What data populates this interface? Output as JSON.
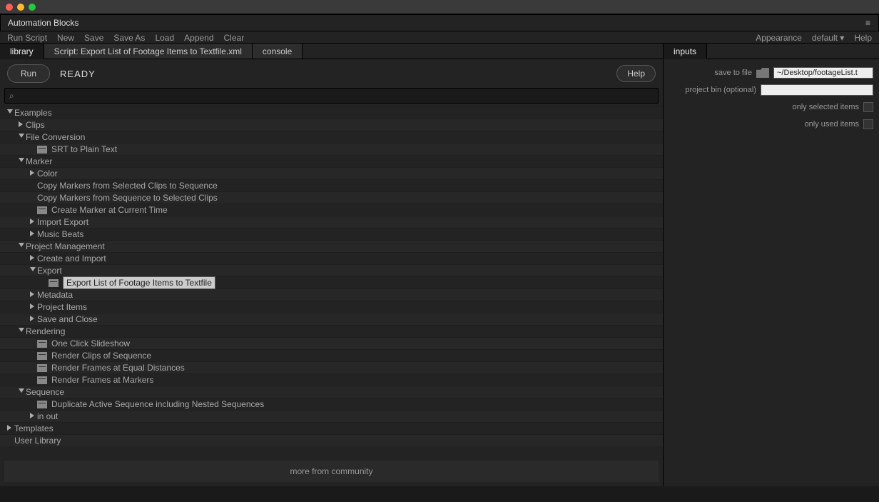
{
  "panel_title": "Automation Blocks",
  "toolbar": {
    "items": [
      "Run Script",
      "New",
      "Save",
      "Save As",
      "Load",
      "Append",
      "Clear"
    ],
    "right": {
      "appearance": "Appearance",
      "preset": "default",
      "help": "Help"
    }
  },
  "tabs": {
    "library": "library",
    "script": "Script: Export List of Footage Items to Textfile.xml",
    "console": "console"
  },
  "run_button": "Run",
  "status": "READY",
  "help_button": "Help",
  "search_placeholder": "",
  "more_row": "more from community",
  "right_panel": {
    "tab": "inputs",
    "rows": {
      "save_to_file": {
        "label": "save to file",
        "value": "~/Desktop/footageList.t"
      },
      "project_bin": {
        "label": "project bin (optional)",
        "value": ""
      },
      "only_selected": {
        "label": "only selected items",
        "checked": false
      },
      "only_used": {
        "label": "only used items",
        "checked": false
      }
    }
  },
  "tree": [
    {
      "d": 0,
      "a": "down",
      "t": "Examples"
    },
    {
      "d": 1,
      "a": "right",
      "t": "Clips"
    },
    {
      "d": 1,
      "a": "down",
      "t": "File Conversion"
    },
    {
      "d": 2,
      "a": "",
      "i": true,
      "t": "SRT to Plain Text"
    },
    {
      "d": 1,
      "a": "down",
      "t": "Marker"
    },
    {
      "d": 2,
      "a": "right",
      "t": "Color"
    },
    {
      "d": 2,
      "a": "",
      "t": "Copy Markers from Selected Clips to Sequence"
    },
    {
      "d": 2,
      "a": "",
      "t": "Copy Markers from Sequence to Selected Clips"
    },
    {
      "d": 2,
      "a": "",
      "i": true,
      "t": "Create Marker at Current Time"
    },
    {
      "d": 2,
      "a": "right",
      "t": "Import Export"
    },
    {
      "d": 2,
      "a": "right",
      "t": "Music Beats"
    },
    {
      "d": 1,
      "a": "down",
      "t": "Project Management"
    },
    {
      "d": 2,
      "a": "right",
      "t": "Create and Import"
    },
    {
      "d": 2,
      "a": "down",
      "t": "Export"
    },
    {
      "d": 3,
      "a": "",
      "i": true,
      "t": "Export List of Footage Items to Textfile",
      "sel": true
    },
    {
      "d": 2,
      "a": "right",
      "t": "Metadata"
    },
    {
      "d": 2,
      "a": "right",
      "t": "Project Items"
    },
    {
      "d": 2,
      "a": "right",
      "t": "Save and Close"
    },
    {
      "d": 1,
      "a": "down",
      "t": "Rendering"
    },
    {
      "d": 2,
      "a": "",
      "i": true,
      "t": "One Click Slideshow"
    },
    {
      "d": 2,
      "a": "",
      "i": true,
      "t": "Render Clips of Sequence"
    },
    {
      "d": 2,
      "a": "",
      "i": true,
      "t": "Render Frames at Equal Distances"
    },
    {
      "d": 2,
      "a": "",
      "i": true,
      "t": "Render Frames at Markers"
    },
    {
      "d": 1,
      "a": "down",
      "t": "Sequence"
    },
    {
      "d": 2,
      "a": "",
      "i": true,
      "t": "Duplicate Active Sequence including Nested Sequences"
    },
    {
      "d": 2,
      "a": "right",
      "t": "in out"
    },
    {
      "d": 0,
      "a": "right",
      "t": "Templates"
    },
    {
      "d": 0,
      "a": "",
      "t": "User Library"
    }
  ]
}
